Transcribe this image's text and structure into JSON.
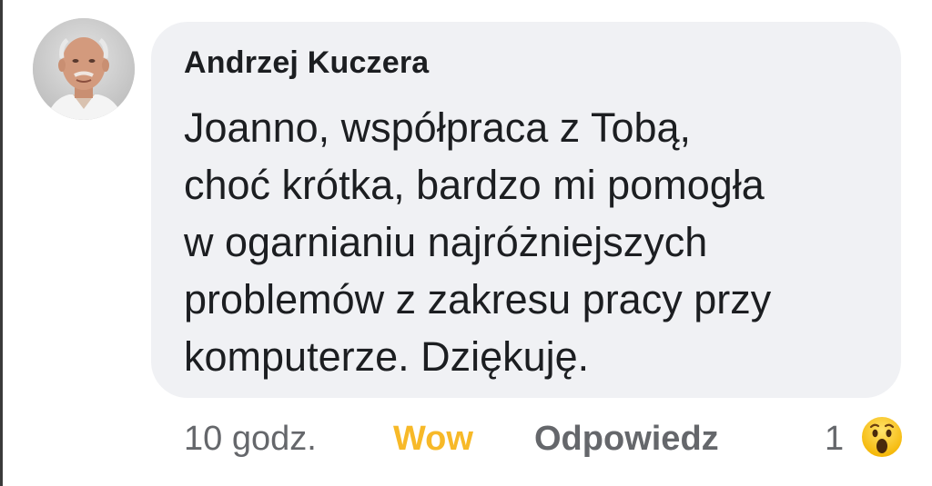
{
  "comment": {
    "author": "Andrzej Kuczera",
    "text_lines": [
      "Joanno, współpraca z Tobą,",
      "choć krótka, bardzo mi pomogła",
      "w ogarnianiu najróżniejszych",
      "problemów z zakresu pracy przy",
      "komputerze. Dziękuję."
    ],
    "time": "10 godz.",
    "reaction_label": "Wow",
    "reply_label": "Odpowiedz",
    "reaction_count": "1",
    "reaction_icon": "wow-emoji-icon"
  },
  "colors": {
    "bubble": "#f0f1f4",
    "text": "#1c1e21",
    "secondary": "#65676b",
    "wow": "#f7b928"
  }
}
